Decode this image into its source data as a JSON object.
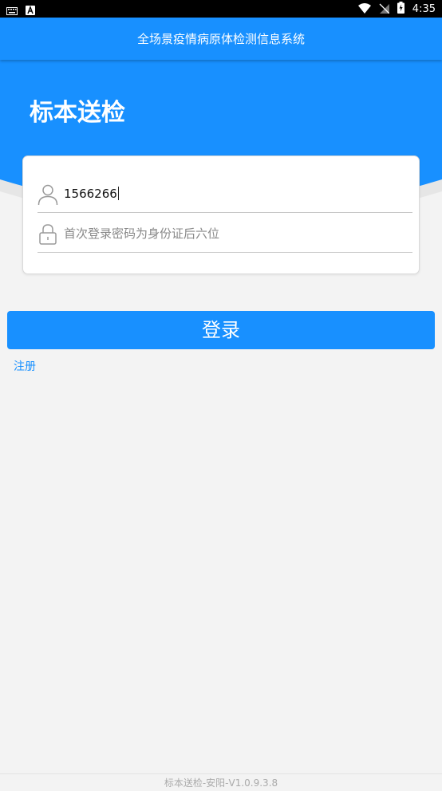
{
  "status_bar": {
    "time": "4:35",
    "icons": [
      "keyboard-icon",
      "a-notification-icon",
      "wifi-icon",
      "no-sim-icon",
      "battery-charging-icon"
    ]
  },
  "app_bar": {
    "title": "全场景疫情病原体检测信息系统"
  },
  "header": {
    "title": "标本送检",
    "color": "#1890ff"
  },
  "login_form": {
    "username": {
      "value": "1566266",
      "icon": "user-icon"
    },
    "password": {
      "placeholder": "首次登录密码为身份证后六位",
      "icon": "lock-icon"
    }
  },
  "actions": {
    "login_label": "登录",
    "register_label": "注册"
  },
  "footer": {
    "version_text": "标本送检-安阳-V1.0.9.3.8"
  }
}
